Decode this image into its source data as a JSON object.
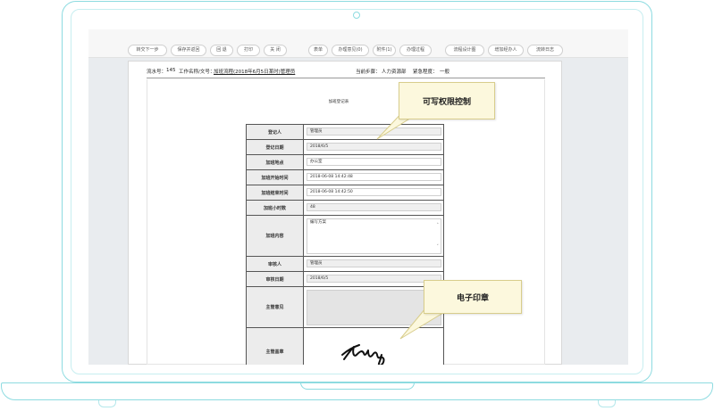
{
  "toolbar": {
    "buttons": [
      "转交下一步",
      "保存并返回",
      "回 退",
      "打印",
      "关 闭",
      "表单",
      "办理意见(0)",
      "附件(1)",
      "办理过程",
      "流程设计图",
      "增加经办人",
      "流转日志"
    ]
  },
  "info_bar": {
    "flow_no_label": "流水号：",
    "flow_no": "145",
    "work_label": "工作名称/文号：",
    "work_name": "加班流程(2018年6月5日某时)管理员",
    "step_label": "当前步骤：",
    "step": "人力资源部",
    "urgency_label": "紧急程度：",
    "urgency": "一般"
  },
  "form": {
    "title": "加班登记表",
    "rows": [
      {
        "label": "登记人",
        "value": "管理员"
      },
      {
        "label": "登记日期",
        "value": "2018/6/5"
      },
      {
        "label": "加班地点",
        "value": "办公室"
      },
      {
        "label": "加班开始时间",
        "value": "2018-06-08 14:42:48"
      },
      {
        "label": "加班结束时间",
        "value": "2018-06-08 14:42:50"
      },
      {
        "label": "加班小时数",
        "value": "48"
      },
      {
        "label": "加班内容",
        "value": "编写方案"
      },
      {
        "label": "审核人",
        "value": "管理员"
      },
      {
        "label": "审核日期",
        "value": "2018/6/5"
      },
      {
        "label": "主管意见",
        "value": ""
      },
      {
        "label": "主管盖章",
        "value": ""
      }
    ]
  },
  "callouts": {
    "permission": "可写权限控制",
    "seal": "电子印章"
  },
  "colors": {
    "frame": "#8ddbe0",
    "callout_bg": "#fcf8dd",
    "label_bg": "#ececec"
  }
}
